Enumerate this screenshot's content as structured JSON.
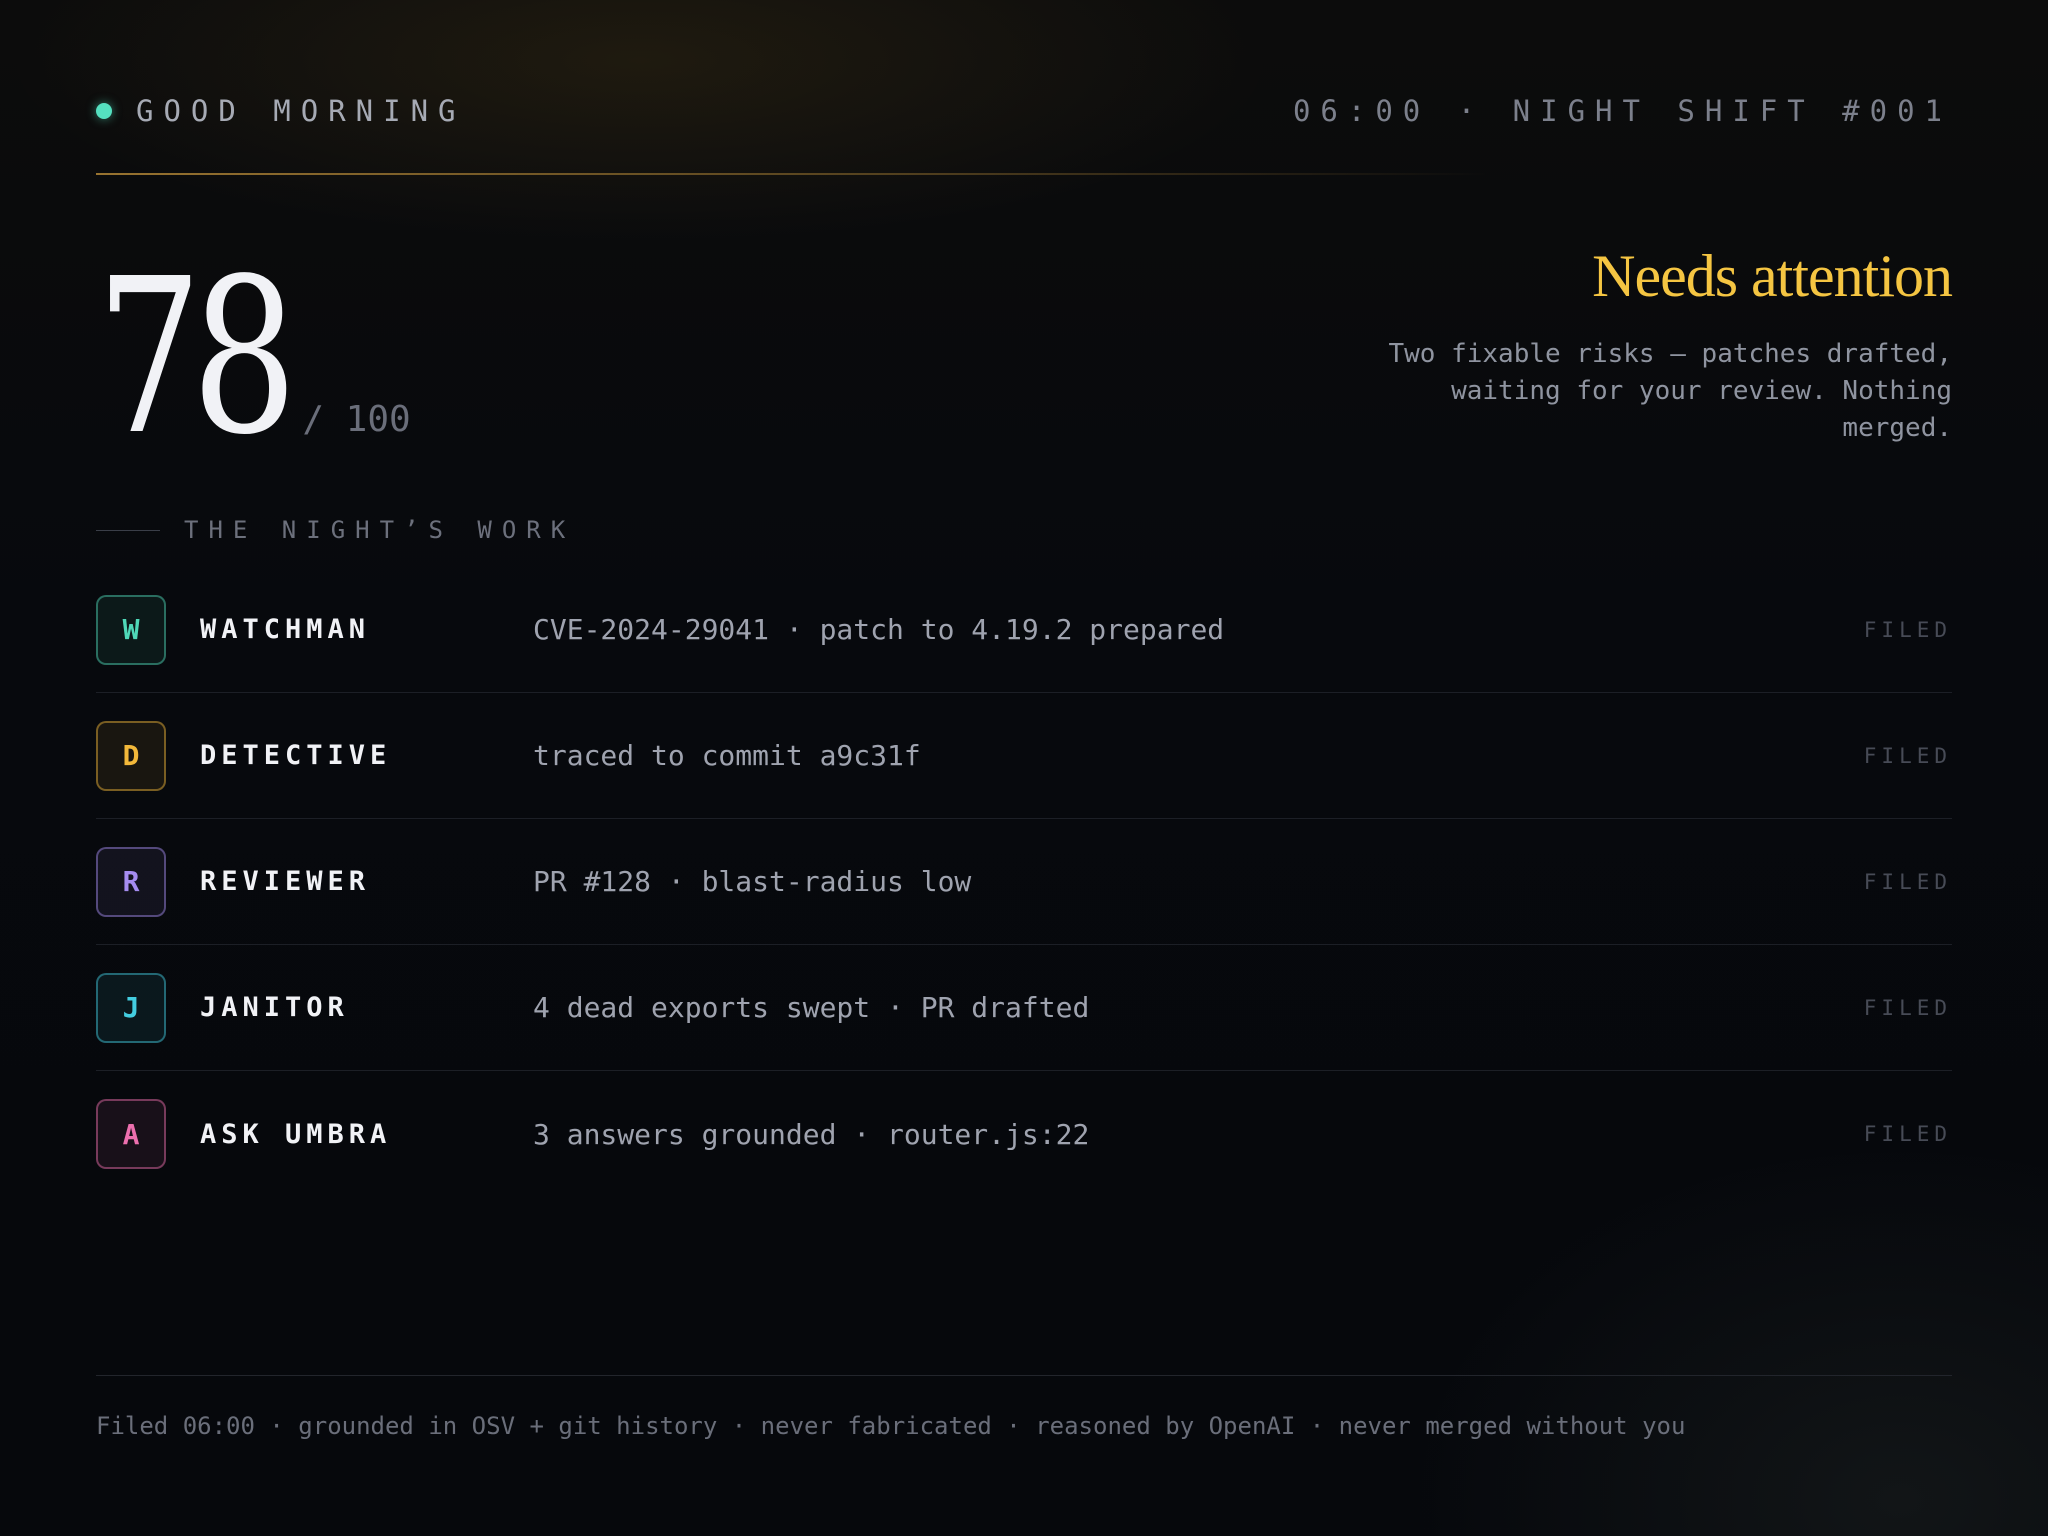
{
  "header": {
    "greeting": "GOOD MORNING",
    "shift": "06:00 · NIGHT SHIFT #001"
  },
  "score": {
    "value": "78",
    "max": "/ 100"
  },
  "status": {
    "title": "Needs attention",
    "description": "Two fixable risks — patches drafted, waiting for your review. Nothing merged."
  },
  "section": {
    "label": "THE NIGHT’S WORK"
  },
  "agents": [
    {
      "initial": "W",
      "name": "WATCHMAN",
      "summary": "CVE-2024-29041 · patch to 4.19.2 prepared",
      "status": "FILED",
      "color": "#4fd8b8"
    },
    {
      "initial": "D",
      "name": "DETECTIVE",
      "summary": "traced to commit a9c31f",
      "status": "FILED",
      "color": "#f2b83a"
    },
    {
      "initial": "R",
      "name": "REVIEWER",
      "summary": "PR #128 · blast-radius low",
      "status": "FILED",
      "color": "#a58cf0"
    },
    {
      "initial": "J",
      "name": "JANITOR",
      "summary": "4 dead exports swept · PR drafted",
      "status": "FILED",
      "color": "#43cde0"
    },
    {
      "initial": "A",
      "name": "ASK UMBRA",
      "summary": "3 answers grounded · router.js:22",
      "status": "FILED",
      "color": "#ec6fae"
    }
  ],
  "footer": {
    "text": "Filed 06:00 · grounded in OSV + git history · never fabricated · reasoned by OpenAI · never merged without you"
  },
  "colors": {
    "accent_gold": "#f5c542",
    "status_dot": "#55e0c0",
    "background": "#06080c"
  }
}
